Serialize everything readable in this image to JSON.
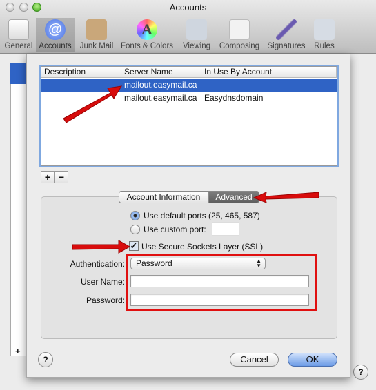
{
  "window": {
    "title": "Accounts"
  },
  "toolbar": [
    {
      "label": "General",
      "icon": "light-switch-icon"
    },
    {
      "label": "Accounts",
      "icon": "at-sign-icon"
    },
    {
      "label": "Junk Mail",
      "icon": "junk-mail-bag-icon"
    },
    {
      "label": "Fonts & Colors",
      "icon": "fonts-colors-icon"
    },
    {
      "label": "Viewing",
      "icon": "viewing-glasses-icon"
    },
    {
      "label": "Composing",
      "icon": "composing-pencil-icon"
    },
    {
      "label": "Signatures",
      "icon": "signature-pen-icon"
    },
    {
      "label": "Rules",
      "icon": "rules-arrows-icon"
    }
  ],
  "table": {
    "headers": [
      "Description",
      "Server Name",
      "In Use By Account"
    ],
    "rows": [
      {
        "description": "",
        "server": "mailout.easymail.ca",
        "account": ""
      },
      {
        "description": "",
        "server": "mailout.easymail.ca",
        "account": "Easydnsdomain"
      }
    ]
  },
  "buttons": {
    "add": "+",
    "remove": "−",
    "cancel": "Cancel",
    "ok": "OK",
    "help": "?"
  },
  "tabs": [
    {
      "label": "Account Information",
      "selected": false
    },
    {
      "label": "Advanced",
      "selected": true
    }
  ],
  "ports": {
    "default_label": "Use default ports (25, 465, 587)",
    "custom_label": "Use custom port:",
    "selected": "default",
    "custom_value": ""
  },
  "ssl": {
    "label": "Use Secure Sockets Layer (SSL)",
    "checked": true
  },
  "auth": {
    "label": "Authentication:",
    "value": "Password"
  },
  "username": {
    "label": "User Name:",
    "value": ""
  },
  "password": {
    "label": "Password:",
    "value": ""
  },
  "colors": {
    "selection": "#2f63c5",
    "annotation": "#e01010"
  }
}
